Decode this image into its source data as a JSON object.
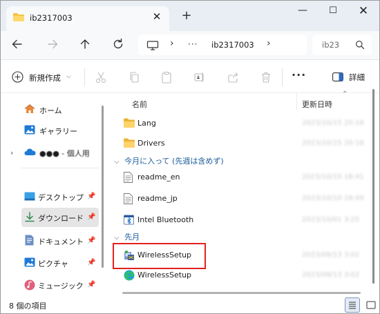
{
  "tab": {
    "title": "ib2317003",
    "close": "✕"
  },
  "titlebar": {
    "new_tab": "+",
    "minimize": "—",
    "maximize": "☐",
    "close": "✕"
  },
  "address": {
    "dots": "···",
    "crumb": "ib2317003",
    "chev": "›"
  },
  "search": {
    "placeholder": "ib23"
  },
  "toolbar": {
    "new_label": "新規作成",
    "more": "···",
    "details_label": "詳細"
  },
  "sidebar": {
    "items": [
      {
        "label": "ホーム",
        "icon": "home-icon"
      },
      {
        "label": "ギャラリー",
        "icon": "gallery-icon"
      },
      {
        "label": "●●● - 個人用",
        "icon": "onedrive-icon"
      },
      {
        "label": "デスクトップ",
        "icon": "desktop-icon",
        "pinned": true
      },
      {
        "label": "ダウンロード",
        "icon": "download-icon",
        "pinned": true,
        "selected": true
      },
      {
        "label": "ドキュメント",
        "icon": "documents-icon",
        "pinned": true
      },
      {
        "label": "ピクチャ",
        "icon": "pictures-icon",
        "pinned": true
      },
      {
        "label": "ミュージック",
        "icon": "music-icon",
        "pinned": true
      }
    ]
  },
  "columns": {
    "name": "名前",
    "modified": "更新日時"
  },
  "groups": {
    "this_month": "今月に入って (先週は含めず)",
    "last_month": "先月"
  },
  "files": [
    {
      "name": "Lang",
      "date": "2023/10/15 20:18",
      "icon": "folder-icon"
    },
    {
      "name": "Drivers",
      "date": "2023/10/15 20:18",
      "icon": "folder-icon"
    },
    {
      "name": "readme_en",
      "date": "2023/10/10 18:41",
      "icon": "text-file-icon"
    },
    {
      "name": "readme_jp",
      "date": "2023/10/10 18:49",
      "icon": "text-file-icon"
    },
    {
      "name": "Intel Bluetooth",
      "date": "2023/10/01 3:25",
      "icon": "bluetooth-app-icon"
    },
    {
      "name": "WirelessSetup",
      "date": "2023/09/13 3:02",
      "icon": "installer-icon"
    },
    {
      "name": "WirelessSetup",
      "date": "2023/09/13 3:02",
      "icon": "edge-icon"
    }
  ],
  "status": {
    "text": "8 個の項目"
  },
  "colors": {
    "accent": "#0067c0",
    "highlight_border": "#e2201c",
    "group_text": "#1a5a9a",
    "folder": "#f4c542"
  },
  "pin_glyph": "📌"
}
